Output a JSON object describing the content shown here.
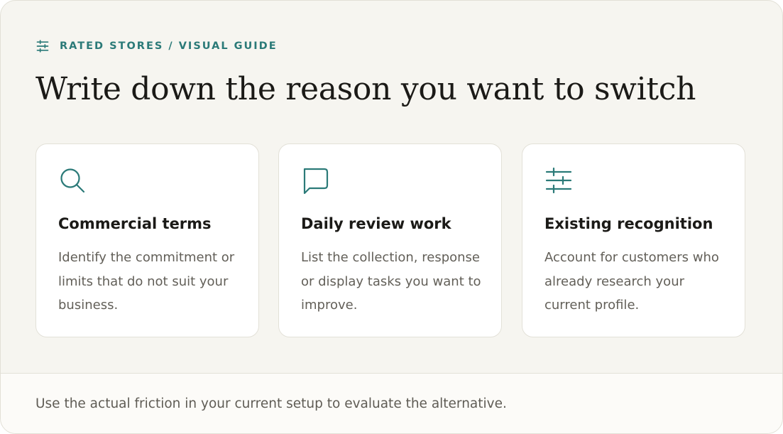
{
  "eyebrow": {
    "icon": "sliders-icon",
    "text": "RATED STORES / VISUAL GUIDE"
  },
  "title": "Write down the reason you want to switch",
  "cards": [
    {
      "icon": "search-icon",
      "title": "Commercial terms",
      "body": "Identify the commitment or limits that do not suit your business."
    },
    {
      "icon": "message-icon",
      "title": "Daily review work",
      "body": "List the collection, response or display tasks you want to improve."
    },
    {
      "icon": "sliders-icon",
      "title": "Existing recognition",
      "body": "Account for customers who already research your current profile."
    }
  ],
  "footer": {
    "text": "Use the actual friction in your current setup to evaluate the alternative."
  },
  "colors": {
    "accent": "#2b7a78",
    "background": "#f6f5f0",
    "card": "#ffffff",
    "title": "#1b1a17",
    "body": "#625f58"
  }
}
